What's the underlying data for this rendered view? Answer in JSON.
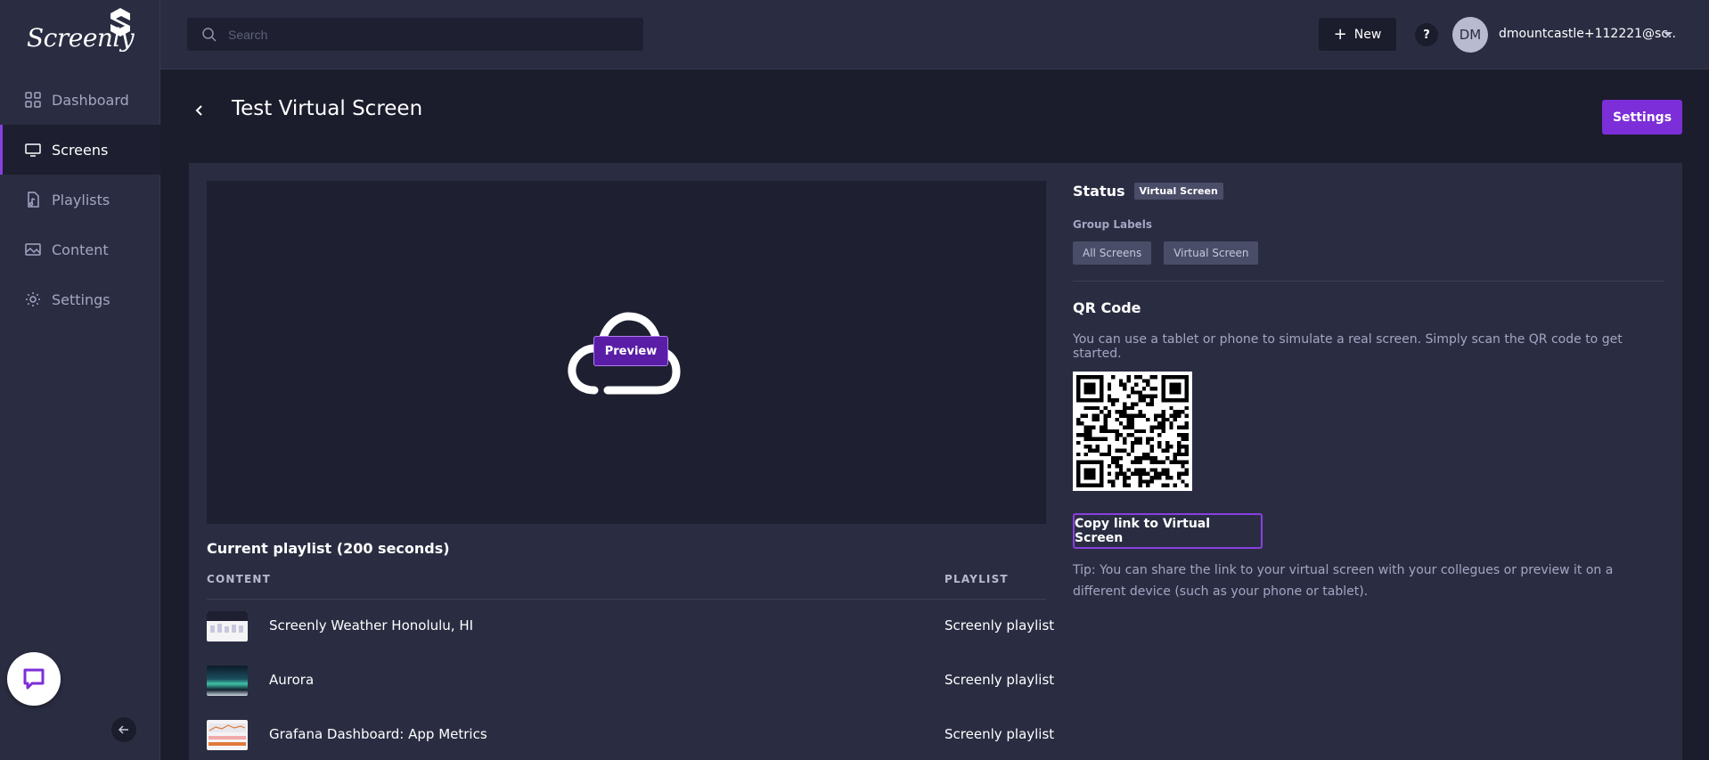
{
  "app": {
    "logo_text": "Screenly"
  },
  "sidebar": {
    "items": [
      {
        "label": "Dashboard",
        "icon": "dashboard-icon",
        "active": false
      },
      {
        "label": "Screens",
        "icon": "screen-icon",
        "active": true
      },
      {
        "label": "Playlists",
        "icon": "playlist-icon",
        "active": false
      },
      {
        "label": "Content",
        "icon": "image-icon",
        "active": false
      },
      {
        "label": "Settings",
        "icon": "gear-icon",
        "active": false
      }
    ]
  },
  "topbar": {
    "search_placeholder": "Search",
    "new_label": "New",
    "help_label": "?",
    "user_initials": "DM",
    "user_name": "dmountcastle+112221@sc..."
  },
  "page": {
    "title": "Test Virtual Screen",
    "settings_label": "Settings"
  },
  "preview": {
    "button_label": "Preview"
  },
  "playlist": {
    "title": "Current playlist (200 seconds)",
    "col_content": "CONTENT",
    "col_playlist": "PLAYLIST",
    "rows": [
      {
        "name": "Screenly Weather Honolulu, HI",
        "playlist": "Screenly playlist",
        "thumb": "weather"
      },
      {
        "name": "Aurora",
        "playlist": "Screenly playlist",
        "thumb": "aurora"
      },
      {
        "name": "Grafana Dashboard: App Metrics",
        "playlist": "Screenly playlist",
        "thumb": "grafana"
      }
    ]
  },
  "details": {
    "status_label": "Status",
    "status_badge": "Virtual Screen",
    "group_labels_title": "Group Labels",
    "group_labels": [
      "All Screens",
      "Virtual Screen"
    ],
    "qr_title": "QR Code",
    "qr_description": "You can use a tablet or phone to simulate a real screen. Simply scan the QR code to get started.",
    "copy_link_label": "Copy link to Virtual Screen",
    "tip": "Tip: You can share the link to your virtual screen with your collegues or preview it on a different device (such as your phone or tablet)."
  },
  "colors": {
    "accent": "#7c2ed8",
    "sidebar_bg": "#2a2d42",
    "page_bg": "#1b1d2c"
  }
}
